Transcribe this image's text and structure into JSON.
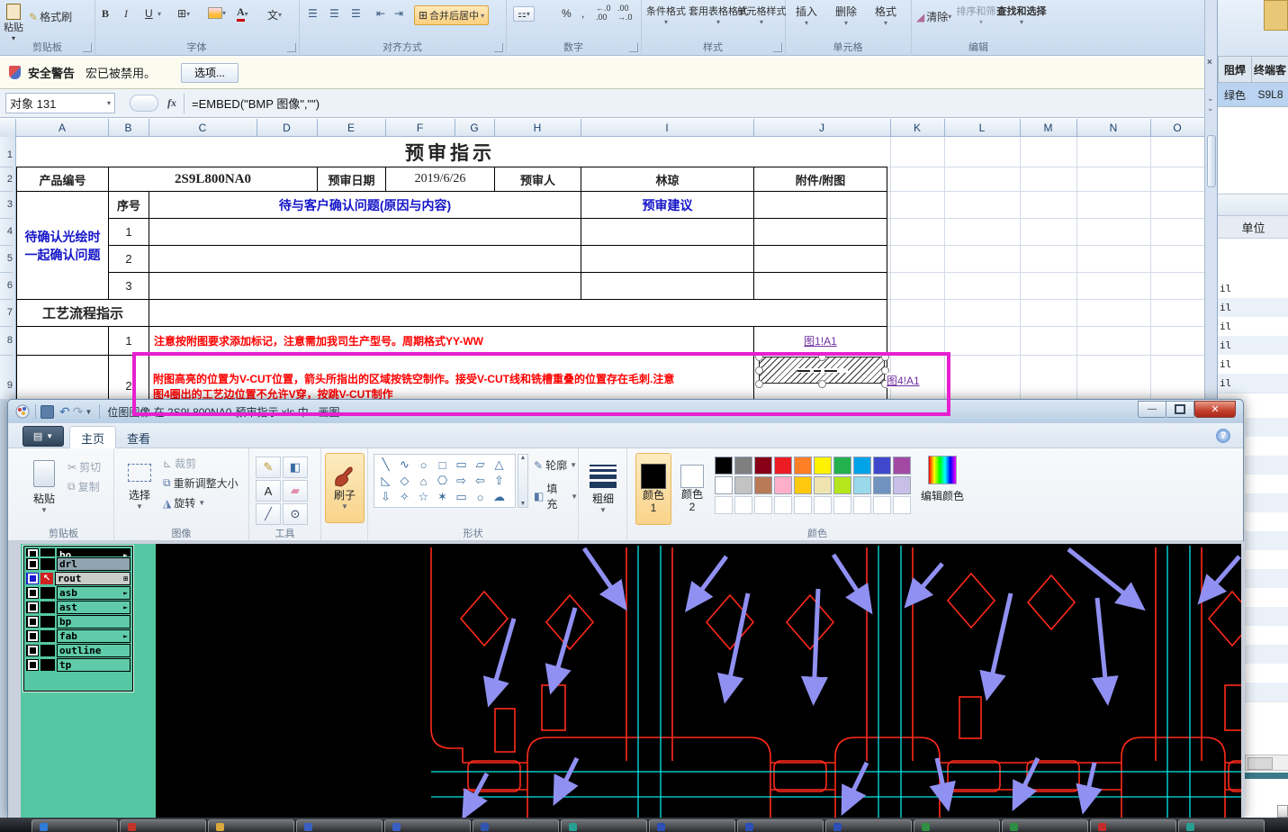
{
  "excel": {
    "ribbon": {
      "paste": "粘贴",
      "format_painter": "格式刷",
      "clipboard_label": "剪贴板",
      "bold": "B",
      "italic": "I",
      "underline": "U",
      "font_label": "字体",
      "merge_center": "合并后居中",
      "align_label": "对齐方式",
      "percent": "%",
      "comma": ",",
      "number_label": "数字",
      "styles": {
        "label": "样式",
        "conditional": "条件格式",
        "format_as_table": "套用表格格式",
        "cell_styles": "单元格样式"
      },
      "cells": {
        "label": "单元格",
        "insert": "插入",
        "delete": "删除",
        "format": "格式"
      },
      "editing": {
        "label": "编辑",
        "clear": "清除",
        "sort_filter": "排序和筛选",
        "find_select": "查找和选择"
      }
    },
    "security": {
      "warning": "安全警告",
      "message": "宏已被禁用。",
      "options": "选项..."
    },
    "formula_bar": {
      "name_box": "对象 131",
      "fx": "fx",
      "formula": "=EMBED(\"BMP 图像\",\"\")"
    },
    "columns": [
      "A",
      "B",
      "C",
      "D",
      "E",
      "F",
      "G",
      "H",
      "I",
      "J",
      "K",
      "L",
      "M",
      "N",
      "O"
    ],
    "rows": [
      "1",
      "2",
      "3",
      "4",
      "5",
      "6",
      "7",
      "8",
      "9"
    ],
    "table": {
      "title": "预审指示",
      "product_label": "产品编号",
      "product_value": "2S9L800NA0",
      "date_label": "预审日期",
      "date_value": "2019/6/26",
      "reviewer_label": "预审人",
      "reviewer_value": "林琼",
      "attachment_label": "附件/附图",
      "seq_label": "序号",
      "question_header": "待与客户确认问题(原因与内容)",
      "suggestion_header": "预审建议",
      "side_note": "待确认光绘时一起确认问题",
      "seq_values": [
        "1",
        "2",
        "3"
      ],
      "process_label": "工艺流程指示",
      "note1_num": "1",
      "note1": "注意按附图要求添加标记，注意需加我司生产型号。周期格式YY-WW",
      "note2_num": "2",
      "note2_line1": "附图高亮的位置为V-CUT位置，箭头所指出的区域按铣空制作。接受V-CUT线和铣槽重叠的位置存在毛刺.注意",
      "note2_line2": "图4圈出的工艺边位置不允许V穿，按跳V-CUT制作",
      "link1": "图1!A1",
      "link2": "图4!A1"
    }
  },
  "side_window": {
    "col1": "阻焊",
    "col2": "终端客",
    "val1": "绿色",
    "val2": "S9L8",
    "unit_header": "单位",
    "unit_rows": [
      "il",
      "il",
      "il",
      "il",
      "il",
      "il"
    ]
  },
  "paint": {
    "title": "位图图像 在 2S9L800NA0-预审指示.xls 中 - 画图",
    "tabs": [
      "主页",
      "查看"
    ],
    "clipboard": {
      "label": "剪贴板",
      "paste": "粘贴",
      "cut": "剪切",
      "copy": "复制"
    },
    "image": {
      "label": "图像",
      "select": "选择",
      "crop": "裁剪",
      "resize": "重新调整大小",
      "rotate": "旋转"
    },
    "tools_label": "工具",
    "brushes": "刷子",
    "shapes": {
      "label": "形状",
      "outline": "轮廓",
      "fill": "填充",
      "glyphs": [
        "╲",
        "∿",
        "○",
        "□",
        "▭",
        "▱",
        "△",
        "◺",
        "◇",
        "⌂",
        "⎔",
        "⇨",
        "⇦",
        "⇧",
        "⇩",
        "✧",
        "☆",
        "✶",
        "▭",
        "○",
        "☁"
      ]
    },
    "size_label": "粗细",
    "colors": {
      "label": "颜色",
      "color1": "颜色1",
      "color2": "颜色2",
      "edit_colors": "编辑颜色",
      "palette_row1": [
        "#000000",
        "#7F7F7F",
        "#880015",
        "#ED1C24",
        "#FF7F27",
        "#FFF200",
        "#22B14C",
        "#00A2E8",
        "#3F48CC",
        "#A349A4"
      ],
      "palette_row2": [
        "#FFFFFF",
        "#C3C3C3",
        "#B97A57",
        "#FFAEC9",
        "#FFC90E",
        "#EFE4B0",
        "#B5E61D",
        "#99D9EA",
        "#7092BE",
        "#C8BFE7"
      ]
    },
    "tool_icons": [
      {
        "g": "✎",
        "c": "#B8901E",
        "name": "pencil-icon"
      },
      {
        "g": "◧",
        "c": "#3A6EA5",
        "name": "fill-icon"
      },
      {
        "g": "A",
        "c": "#222222",
        "name": "text-icon"
      },
      {
        "g": "▰",
        "c": "#E08CA8",
        "name": "eraser-icon"
      },
      {
        "g": "╱",
        "c": "#556688",
        "name": "picker-icon"
      },
      {
        "g": "⊙",
        "c": "#334466",
        "name": "magnifier-icon"
      }
    ]
  },
  "cam": {
    "layers": [
      {
        "name": "bo",
        "bg": "#000000",
        "fg": "#FFFFFF",
        "marker": "►",
        "partial": true
      },
      {
        "name": "drl",
        "bg": "#8FA4AE",
        "fg": "#000000",
        "marker": ""
      },
      {
        "name": "rout",
        "bg": "#CACDCA",
        "fg": "#000000",
        "marker": "⊞",
        "selected": true
      },
      {
        "name": "asb",
        "bg": "#5FCBA9",
        "fg": "#000000",
        "marker": "►"
      },
      {
        "name": "ast",
        "bg": "#5FCBA9",
        "fg": "#000000",
        "marker": "►"
      },
      {
        "name": "bp",
        "bg": "#5FCBA9",
        "fg": "#000000",
        "marker": ""
      },
      {
        "name": "fab",
        "bg": "#5FCBA9",
        "fg": "#000000",
        "marker": "►"
      },
      {
        "name": "outline",
        "bg": "#5FCBA9",
        "fg": "#000000",
        "marker": ""
      },
      {
        "name": "tp",
        "bg": "#5FCBA9",
        "fg": "#000000",
        "marker": ""
      }
    ]
  },
  "taskbar": {
    "buttons": [
      "#2E7CD6",
      "#C23428",
      "#D9A93C",
      "#3B5FC0",
      "#3B5FC0",
      "#2F55B0",
      "#27A093",
      "#2B4FB5",
      "#2B4FB5",
      "#2B4FB5",
      "#2E8F44",
      "#2E8F44",
      "#C32C2C",
      "#27A093"
    ]
  },
  "colors": {
    "selection_magenta": "#E81FD0",
    "canvas_red": "#FF2A1A",
    "canvas_cyan": "#00E8E8",
    "arrow_purple": "#9090F2",
    "panel_teal": "#55C7A3"
  }
}
